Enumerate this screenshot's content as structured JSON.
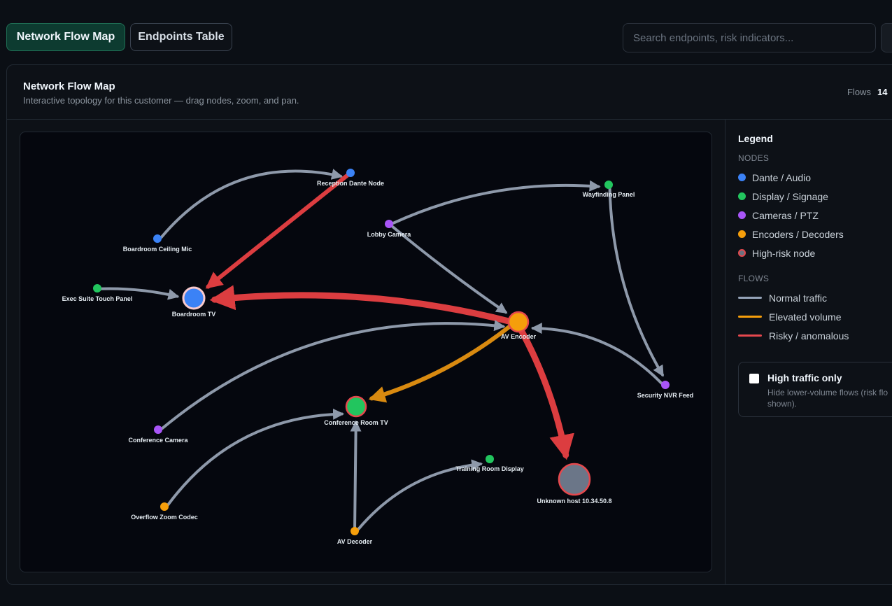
{
  "tabs": {
    "network_flow_map": "Network Flow Map",
    "endpoints_table": "Endpoints Table"
  },
  "search": {
    "placeholder": "Search endpoints, risk indicators...",
    "value": ""
  },
  "panel": {
    "title": "Network Flow Map",
    "subtitle": "Interactive topology for this customer — drag nodes, zoom, and pan.",
    "flows_label": "Flows",
    "flows_count": "14"
  },
  "legend": {
    "title": "Legend",
    "nodes_heading": "NODES",
    "node_types": [
      {
        "label": "Dante / Audio",
        "color": "#3b82f6"
      },
      {
        "label": "Display / Signage",
        "color": "#22c55e"
      },
      {
        "label": "Cameras / PTZ",
        "color": "#a855f7"
      },
      {
        "label": "Encoders / Decoders",
        "color": "#f59e0b"
      },
      {
        "label": "High-risk node",
        "color": "#6b7280"
      }
    ],
    "flows_heading": "FLOWS",
    "flow_types": [
      {
        "label": "Normal traffic",
        "color": "#94a3b8"
      },
      {
        "label": "Elevated volume",
        "color": "#f59e0b"
      },
      {
        "label": "Risky / anomalous",
        "color": "#e5484d"
      }
    ]
  },
  "filter": {
    "title": "High traffic only",
    "description": "Hide lower-volume flows (risk flo shown).",
    "checked": false
  },
  "graph": {
    "colors": {
      "audio": "#3b82f6",
      "display": "#22c55e",
      "camera": "#a855f7",
      "encoder": "#f59e0b",
      "unknown": "#6b7688",
      "normal": "#8e99aa",
      "elevated": "#d98a10",
      "risky": "#dc3d40",
      "risk_ring": "#e5484d"
    },
    "nodes": [
      {
        "id": "reception",
        "label": "Reception Dante Node",
        "type": "audio",
        "risk": false
      },
      {
        "id": "ceilingmic",
        "label": "Boardroom Ceiling Mic",
        "type": "audio",
        "risk": false
      },
      {
        "id": "exec",
        "label": "Exec Suite Touch Panel",
        "type": "display",
        "risk": false
      },
      {
        "id": "boardtv",
        "label": "Boardroom TV",
        "type": "audio",
        "risk": true
      },
      {
        "id": "lobby",
        "label": "Lobby Camera",
        "type": "camera",
        "risk": false
      },
      {
        "id": "wayfinding",
        "label": "Wayfinding Panel",
        "type": "display",
        "risk": false
      },
      {
        "id": "avenc",
        "label": "AV Encoder",
        "type": "encoder",
        "risk": true
      },
      {
        "id": "nvr",
        "label": "Security NVR Feed",
        "type": "camera",
        "risk": false
      },
      {
        "id": "conftv",
        "label": "Conference Room TV",
        "type": "display",
        "risk": true
      },
      {
        "id": "confcam",
        "label": "Conference Camera",
        "type": "camera",
        "risk": false
      },
      {
        "id": "training",
        "label": "Training Room Display",
        "type": "display",
        "risk": false
      },
      {
        "id": "unknown",
        "label": "Unknown host 10.34.50.8",
        "type": "unknown",
        "risk": true
      },
      {
        "id": "overflow",
        "label": "Overflow Zoom Codec",
        "type": "encoder",
        "risk": false
      },
      {
        "id": "avdec",
        "label": "AV Decoder",
        "type": "encoder",
        "risk": false
      }
    ],
    "edges": [
      {
        "from": "ceilingmic",
        "to": "reception",
        "kind": "normal"
      },
      {
        "from": "reception",
        "to": "boardtv",
        "kind": "risky"
      },
      {
        "from": "exec",
        "to": "boardtv",
        "kind": "normal"
      },
      {
        "from": "avenc",
        "to": "boardtv",
        "kind": "risky"
      },
      {
        "from": "lobby",
        "to": "wayfinding",
        "kind": "normal"
      },
      {
        "from": "lobby",
        "to": "avenc",
        "kind": "normal"
      },
      {
        "from": "wayfinding",
        "to": "nvr",
        "kind": "normal"
      },
      {
        "from": "nvr",
        "to": "avenc",
        "kind": "normal"
      },
      {
        "from": "confcam",
        "to": "avenc",
        "kind": "normal"
      },
      {
        "from": "avenc",
        "to": "conftv",
        "kind": "elevated"
      },
      {
        "from": "avenc",
        "to": "unknown",
        "kind": "risky"
      },
      {
        "from": "overflow",
        "to": "conftv",
        "kind": "normal"
      },
      {
        "from": "avdec",
        "to": "conftv",
        "kind": "normal"
      },
      {
        "from": "avdec",
        "to": "training",
        "kind": "normal"
      }
    ]
  }
}
